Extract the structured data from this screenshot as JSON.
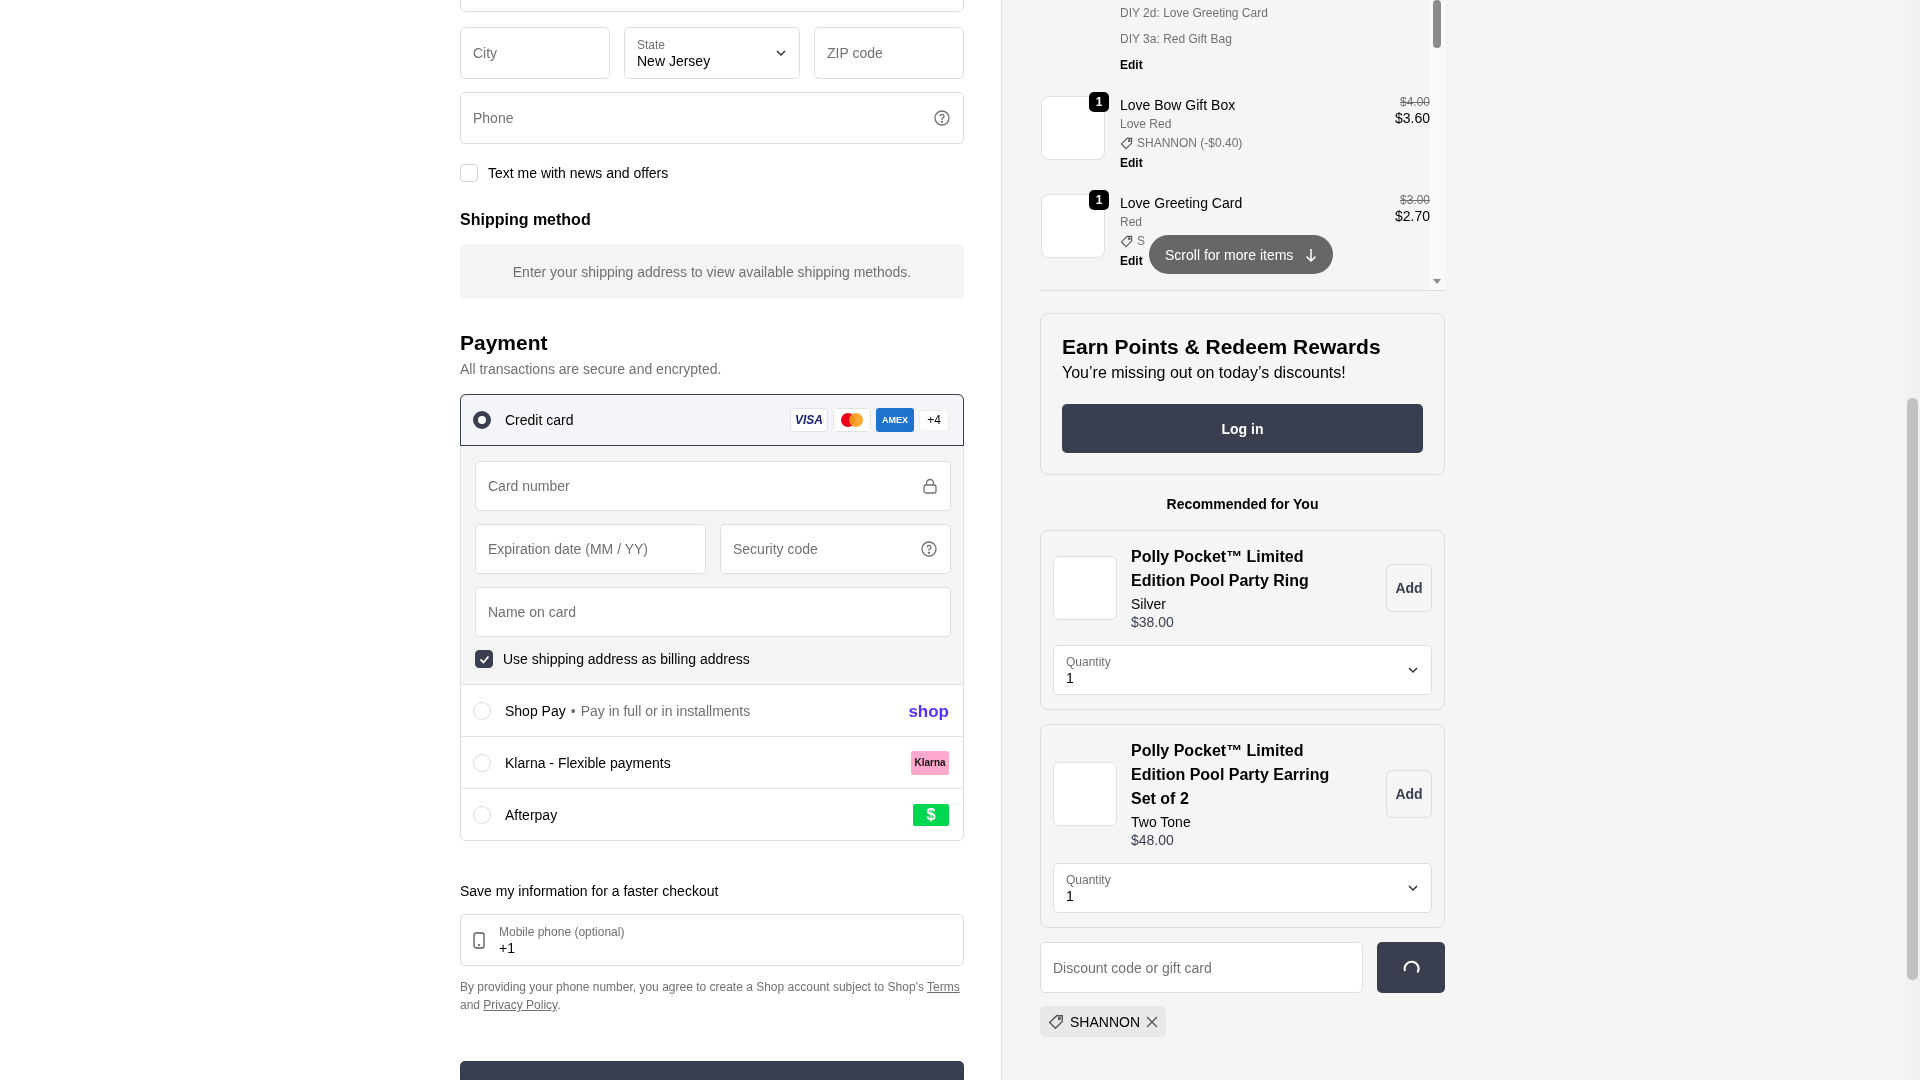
{
  "address_fields": [
    {
      "kind": "text",
      "placeholder": "City"
    },
    {
      "kind": "select",
      "label": "State",
      "value": "New Jersey"
    },
    {
      "kind": "text",
      "placeholder": "ZIP code"
    }
  ],
  "phone_field": {
    "kind": "help",
    "placeholder": "Phone"
  },
  "news_checkbox": {
    "label": "Text me with news and offers",
    "checked": false
  },
  "shipping": {
    "title": "Shipping method",
    "notice": "Enter your shipping address to view available shipping methods."
  },
  "payment": {
    "title": "Payment",
    "subtitle": "All transactions are secure and encrypted.",
    "methods": [
      {
        "label": "Credit card",
        "selected": true,
        "logos": [
          {
            "kind": "visa",
            "text": "VISA"
          },
          {
            "kind": "mastercard"
          },
          {
            "kind": "amex",
            "text": "AMEX"
          },
          {
            "kind": "more",
            "text": "+4"
          }
        ],
        "fields": [
          [
            {
              "kind": "lock",
              "placeholder": "Card number"
            }
          ],
          [
            {
              "kind": "text",
              "placeholder": "Expiration date (MM / YY)"
            },
            {
              "kind": "help",
              "placeholder": "Security code"
            }
          ],
          [
            {
              "kind": "text",
              "placeholder": "Name on card"
            }
          ]
        ],
        "billing_checkbox": {
          "label": "Use shipping address as billing address",
          "checked": true
        }
      },
      {
        "label": "Shop Pay",
        "separator": "•",
        "note": "Pay in full or in installments",
        "selected": false,
        "logos": [
          {
            "kind": "shop",
            "text": "shop"
          }
        ]
      },
      {
        "label": "Klarna - Flexible payments",
        "selected": false,
        "logos": [
          {
            "kind": "klarna",
            "text": "Klarna"
          }
        ]
      },
      {
        "label": "Afterpay",
        "selected": false,
        "logos": [
          {
            "kind": "cash",
            "text": "$"
          }
        ]
      }
    ]
  },
  "save_info": {
    "title": "Save my information for a faster checkout",
    "phone_field": {
      "kind": "phone",
      "label": "Mobile phone (optional)",
      "value": "+1"
    },
    "legal": [
      {
        "kind": "text",
        "text": "By providing your phone number, you agree to create a Shop account subject to Shop's "
      },
      {
        "kind": "link",
        "text": "Terms"
      },
      {
        "kind": "text",
        "text": " and "
      },
      {
        "kind": "link",
        "text": "Privacy Policy"
      },
      {
        "kind": "text",
        "text": "."
      }
    ]
  },
  "order_items": [
    {
      "kind": "continuation",
      "lines": [
        "DIY 2d: Love Greeting Card",
        "DIY 3a: Red Gift Bag"
      ],
      "edit": "Edit"
    },
    {
      "kind": "product",
      "quantity": "1",
      "name": "Love Bow Gift Box",
      "variant": "Love Red",
      "discount": "SHANNON (-$0.40)",
      "original_price": "$4.00",
      "price": "$3.60",
      "edit": "Edit"
    },
    {
      "kind": "product",
      "quantity": "1",
      "name": "Love Greeting Card",
      "variant": "Red",
      "discount": "S",
      "original_price": "$3.00",
      "price": "$2.70",
      "edit": "Edit"
    }
  ],
  "scroll_hint": "Scroll for more items",
  "rewards": {
    "title": "Earn Points & Redeem Rewards",
    "subtitle": "You’re missing out on today’s discounts!",
    "button": "Log in"
  },
  "recommended": {
    "title": "Recommended for You",
    "items": [
      {
        "name": "Polly Pocket™ Limited Edition Pool Party Ring",
        "variant": "Silver",
        "price": "$38.00",
        "button": "Add",
        "quantity": {
          "label": "Quantity",
          "value": "1"
        }
      },
      {
        "name": "Polly Pocket™ Limited Edition Pool Party Earring Set of 2",
        "variant": "Two Tone",
        "price": "$48.00",
        "button": "Add",
        "quantity": {
          "label": "Quantity",
          "value": "1"
        }
      }
    ]
  },
  "discount": {
    "placeholder": "Discount code or gift card",
    "loading": true
  },
  "applied_codes": [
    {
      "code": "SHANNON"
    }
  ]
}
